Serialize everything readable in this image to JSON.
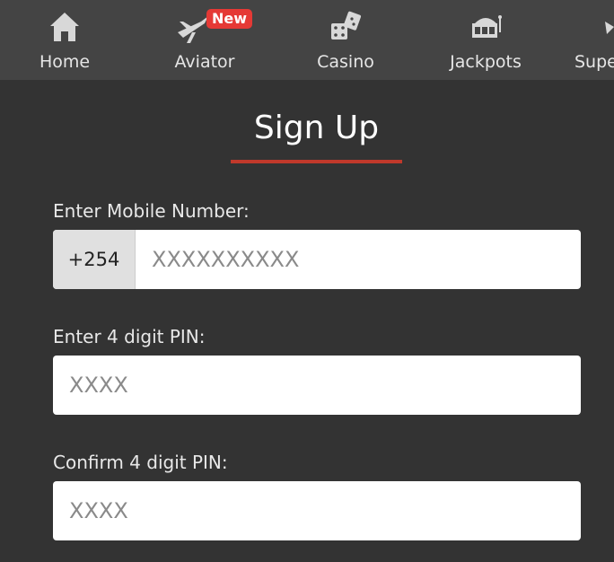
{
  "nav": {
    "items": [
      {
        "label": "Home",
        "icon": "home-icon"
      },
      {
        "label": "Aviator",
        "icon": "airplane-icon",
        "badge": "New"
      },
      {
        "label": "Casino",
        "icon": "dice-icon"
      },
      {
        "label": "Jackpots",
        "icon": "slot-machine-icon"
      },
      {
        "label": "Supe",
        "icon": "super-icon"
      }
    ]
  },
  "form": {
    "title": "Sign Up",
    "mobile_label": "Enter Mobile Number:",
    "country_code": "+254",
    "mobile_placeholder": "XXXXXXXXXX",
    "pin_label": "Enter 4 digit PIN:",
    "pin_placeholder": "XXXX",
    "confirm_label": "Confirm 4 digit PIN:",
    "confirm_placeholder": "XXXX"
  },
  "colors": {
    "accent": "#c0392b",
    "badge": "#e53935",
    "nav_bg": "#444444",
    "page_bg": "#333333"
  }
}
